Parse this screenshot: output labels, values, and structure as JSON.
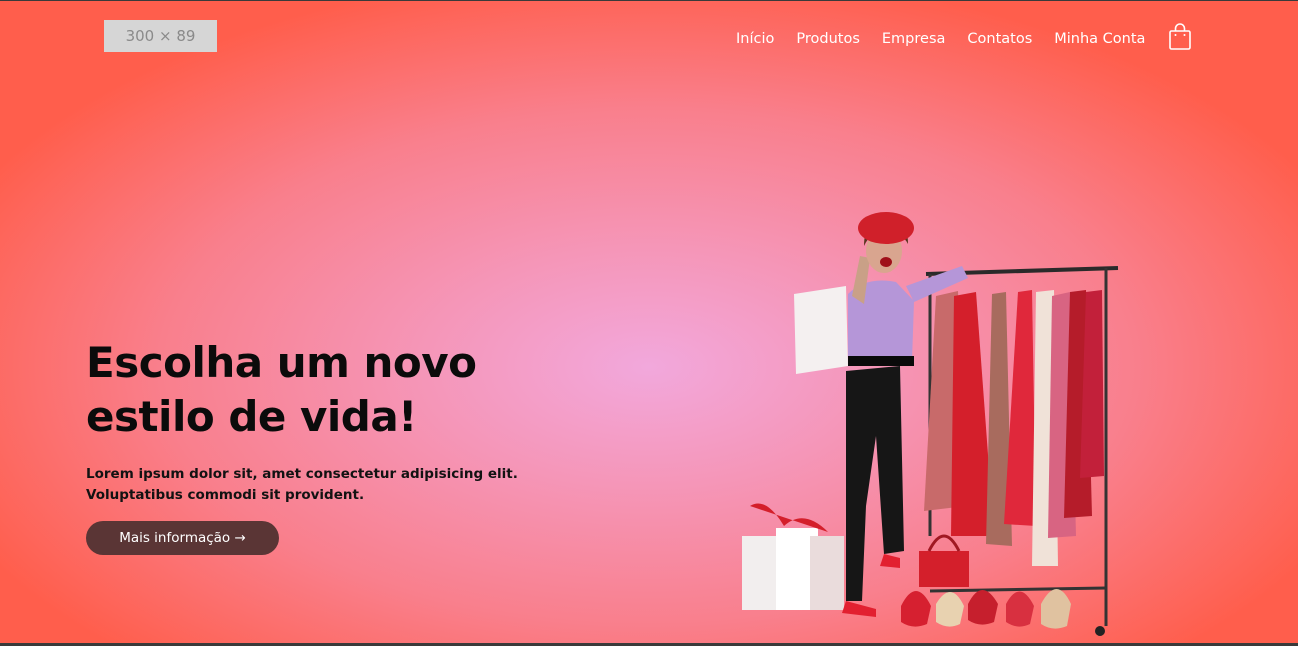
{
  "header": {
    "logo_placeholder": "300 × 89",
    "nav": [
      "Início",
      "Produtos",
      "Empresa",
      "Contatos",
      "Minha Conta"
    ],
    "cart_icon": "shopping-bag-icon"
  },
  "hero": {
    "title": "Escolha um novo estilo de vida!",
    "text": "Lorem ipsum dolor sit, amet consectetur adipisicing elit. Voluptatibus commodi sit provident.",
    "button_label": "Mais informação →"
  },
  "colors": {
    "gradient_center": "#f2a8dc",
    "gradient_edge": "#ff5e4c",
    "button_bg": "#5a3535"
  }
}
